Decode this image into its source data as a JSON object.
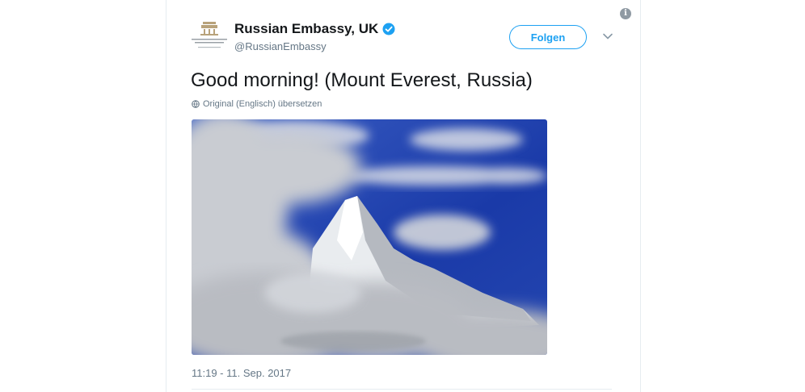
{
  "tweet": {
    "author_name": "Russian Embassy, UK",
    "author_handle": "@RussianEmbassy",
    "follow_label": "Folgen",
    "text": "Good morning! (Mount Everest, Russia)",
    "translate_label": "Original (Englisch) übersetzen",
    "timestamp": "11:19 - 11. Sep. 2017"
  },
  "icons": {
    "info": "info-icon",
    "verified": "verified-badge-icon",
    "chevron": "chevron-down-icon",
    "globe": "globe-icon"
  },
  "colors": {
    "accent": "#1da1f2",
    "secondary_text": "#657786",
    "sky": "#1f3fa6"
  }
}
